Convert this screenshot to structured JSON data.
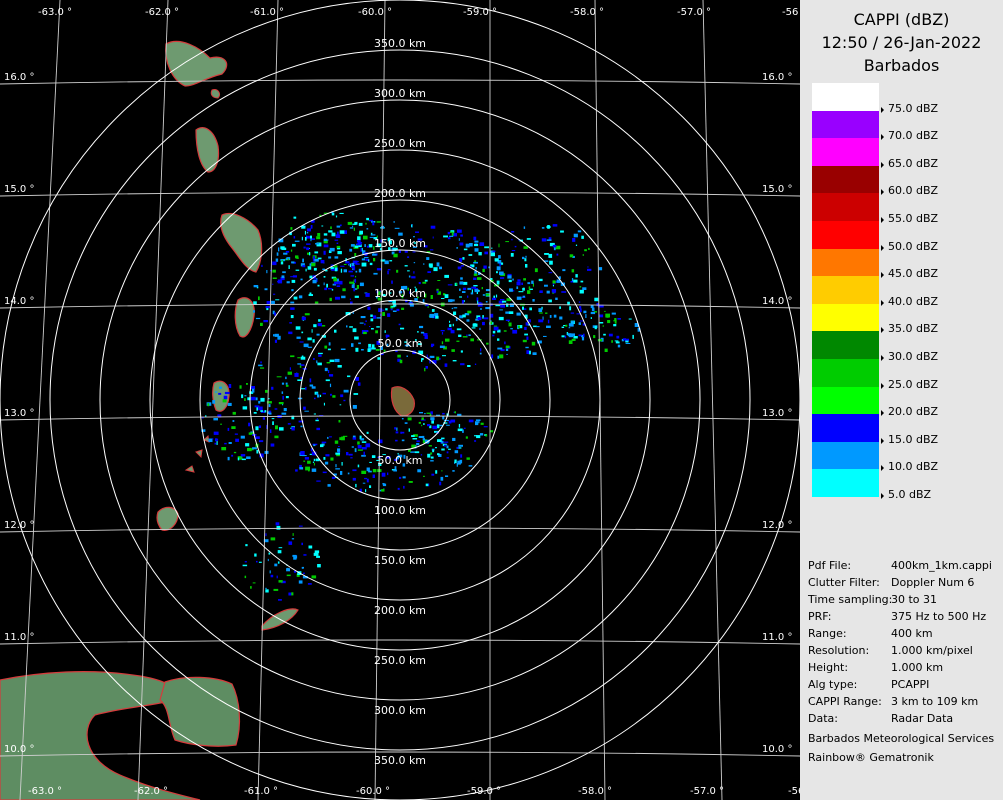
{
  "header": {
    "product": "CAPPI (dBZ)",
    "datetime": "12:50 / 26-Jan-2022",
    "site": "Barbados"
  },
  "legend": [
    {
      "label": "75.0 dBZ",
      "color": "#ffffff"
    },
    {
      "label": "70.0 dBZ",
      "color": "#9900ff"
    },
    {
      "label": "65.0 dBZ",
      "color": "#ff00ff"
    },
    {
      "label": "60.0 dBZ",
      "color": "#990000"
    },
    {
      "label": "55.0 dBZ",
      "color": "#cc0000"
    },
    {
      "label": "50.0 dBZ",
      "color": "#ff0000"
    },
    {
      "label": "45.0 dBZ",
      "color": "#ff7700"
    },
    {
      "label": "40.0 dBZ",
      "color": "#ffcc00"
    },
    {
      "label": "35.0 dBZ",
      "color": "#ffff00"
    },
    {
      "label": "30.0 dBZ",
      "color": "#008800"
    },
    {
      "label": "25.0 dBZ",
      "color": "#00cc00"
    },
    {
      "label": "20.0 dBZ",
      "color": "#00ff00"
    },
    {
      "label": "15.0 dBZ",
      "color": "#0000ff"
    },
    {
      "label": "10.0 dBZ",
      "color": "#0099ff"
    },
    {
      "label": "5.0 dBZ",
      "color": "#00ffff"
    }
  ],
  "info": [
    {
      "key": "Pdf File:",
      "value": "400km_1km.cappi"
    },
    {
      "key": "Clutter Filter:",
      "value": "Doppler Num 6"
    },
    {
      "key": "Time sampling:",
      "value": "30 to 31"
    },
    {
      "key": "PRF:",
      "value": "375 Hz to 500 Hz"
    },
    {
      "key": "Range:",
      "value": "400 km"
    },
    {
      "key": "Resolution:",
      "value": "1.000 km/pixel"
    },
    {
      "key": "Height:",
      "value": "1.000 km"
    },
    {
      "key": "Alg type:",
      "value": "PCAPPI"
    },
    {
      "key": "CAPPI Range:",
      "value": "3 km to 109 km"
    },
    {
      "key": "Data:",
      "value": "Radar Data"
    }
  ],
  "footer": {
    "agency": "Barbados Meteorological Services",
    "software": "Rainbow® Gematronik"
  },
  "map": {
    "lon_labels": [
      "-63.0 °",
      "-62.0 °",
      "-61.0 °",
      "-60.0 °",
      "-59.0 °",
      "-58.0 °",
      "-57.0 °",
      "-56"
    ],
    "lat_labels": [
      "16.0 °",
      "15.0 °",
      "14.0 °",
      "13.0 °",
      "12.0 °",
      "11.0 °",
      "10.0 °"
    ],
    "range_labels_north": [
      "350.0 km",
      "300.0 km",
      "250.0 km",
      "200.0 km",
      "150.0 km",
      "100.0 km",
      "50.0 km"
    ],
    "range_labels_south": [
      "50.0 km",
      "100.0 km",
      "150.0 km",
      "200.0 km",
      "250.0 km",
      "300.0 km",
      "350.0 km"
    ],
    "colors": {
      "grid": "#cfcfcf",
      "land": "#5e8d62",
      "coast": "#d43c3c"
    }
  }
}
